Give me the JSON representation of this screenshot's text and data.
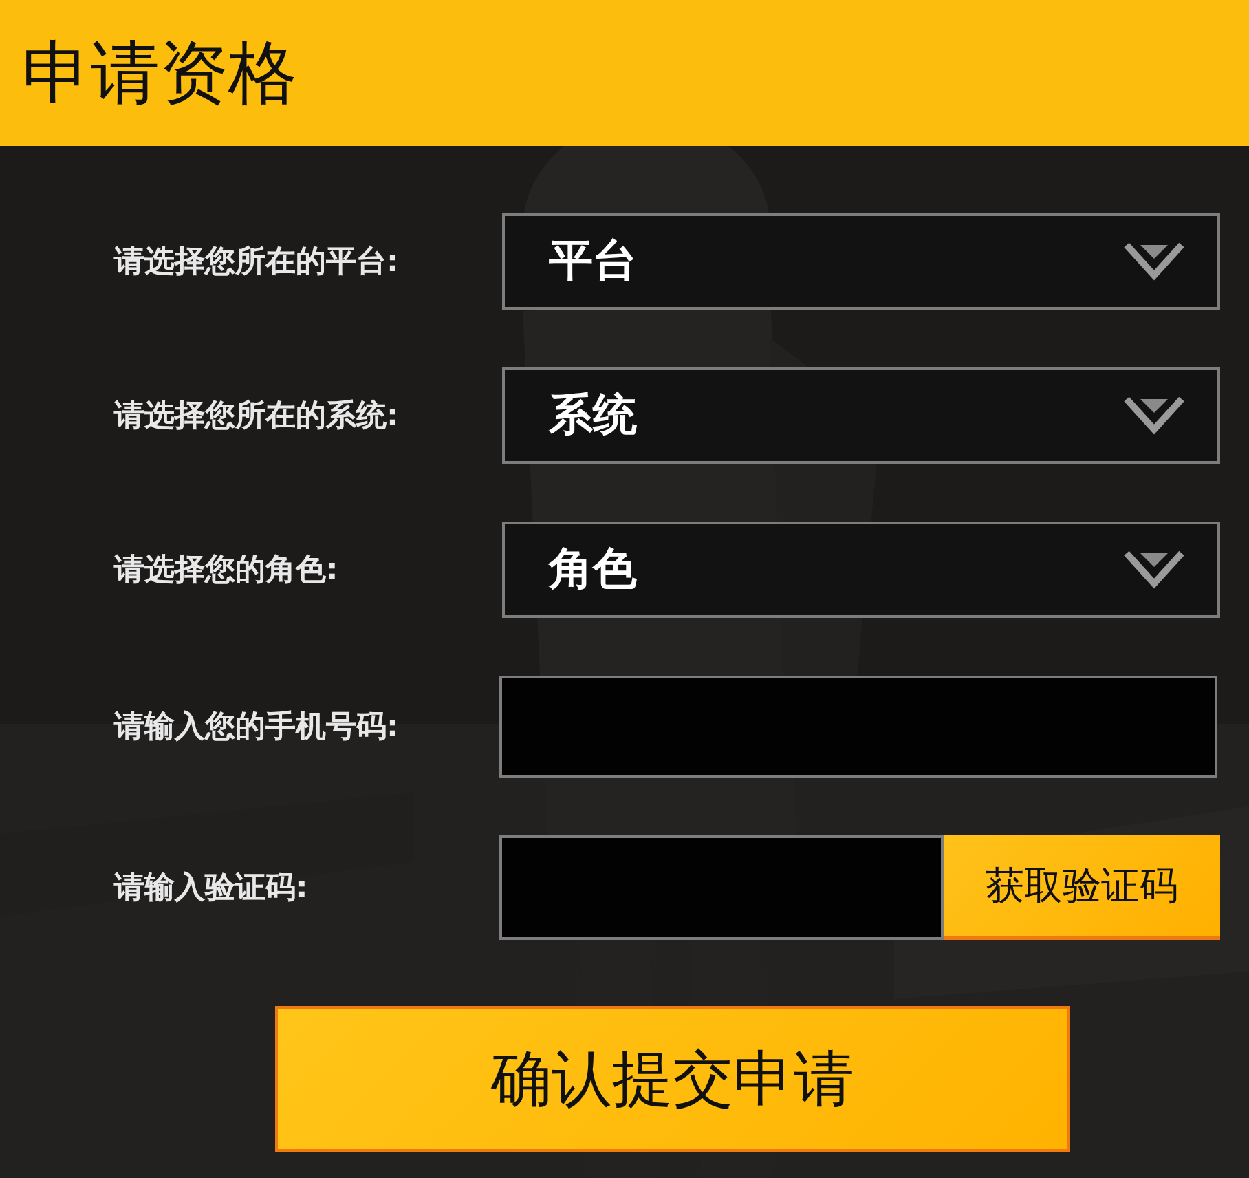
{
  "title": "申请资格",
  "fields": [
    {
      "kind": "select",
      "label": "请选择您所在的平台:",
      "value": "平台"
    },
    {
      "kind": "select",
      "label": "请选择您所在的系统:",
      "value": "系统"
    },
    {
      "kind": "select",
      "label": "请选择您的角色:",
      "value": "角色"
    },
    {
      "kind": "text",
      "label": "请输入您的手机号码:"
    },
    {
      "kind": "code",
      "label": "请输入验证码:",
      "button": "获取验证码"
    }
  ],
  "submit": "确认提交申请"
}
